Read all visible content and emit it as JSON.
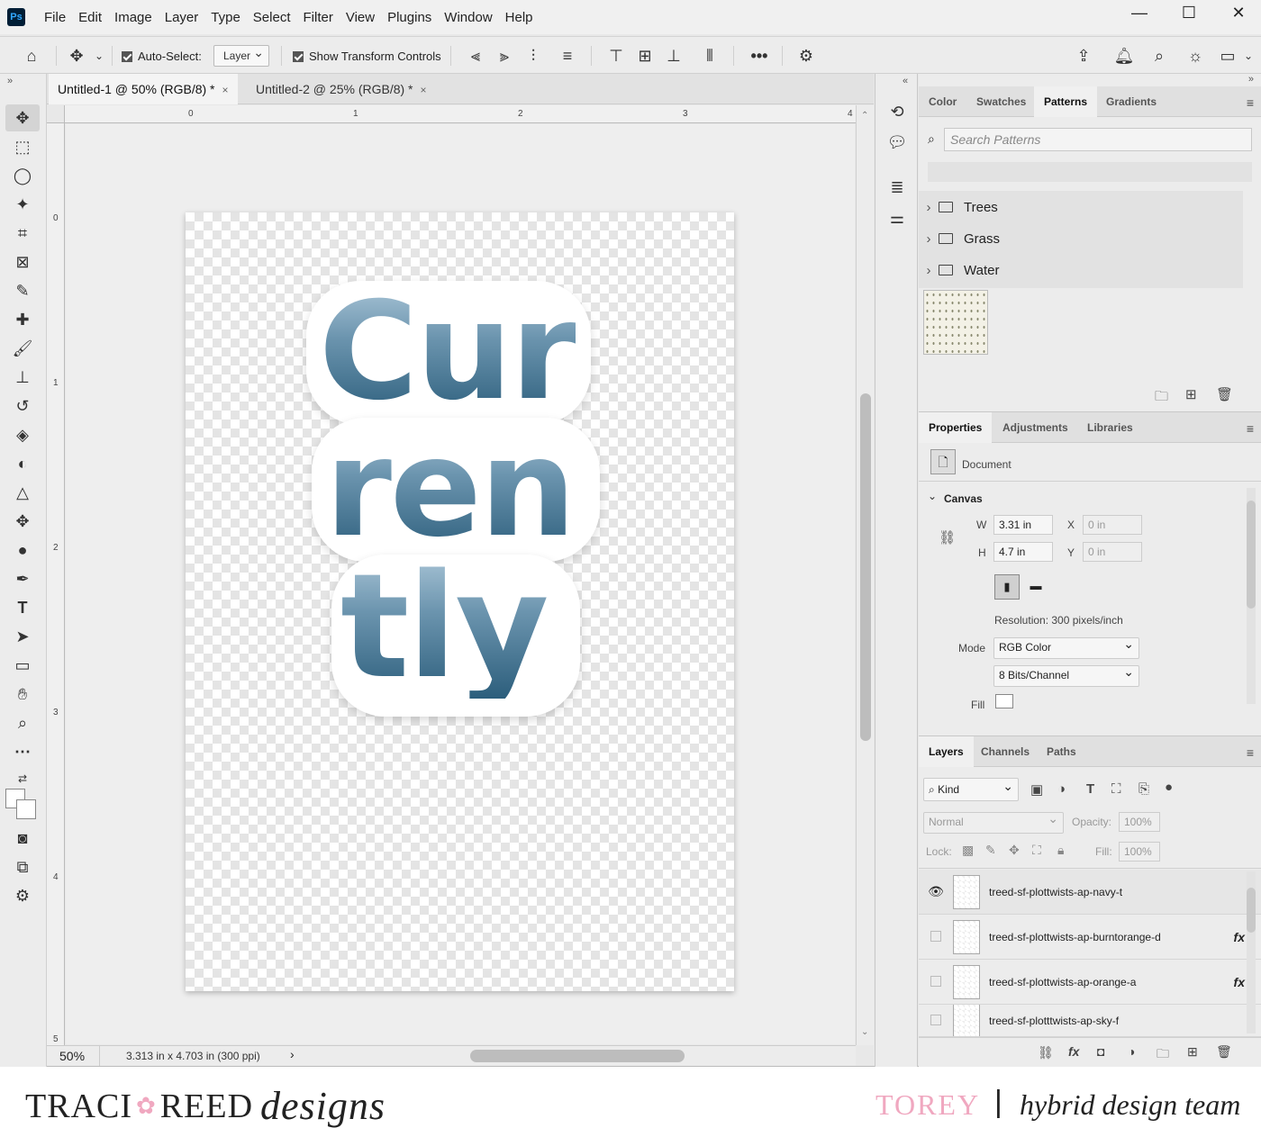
{
  "app": {
    "logo": "Ps"
  },
  "menu": [
    "File",
    "Edit",
    "Image",
    "Layer",
    "Type",
    "Select",
    "Filter",
    "View",
    "Plugins",
    "Window",
    "Help"
  ],
  "window_controls": {
    "minimize": "—",
    "maximize": "☐",
    "close": "✕"
  },
  "options_bar": {
    "auto_select_label": "Auto-Select:",
    "auto_select_target": "Layer",
    "show_transform_label": "Show Transform Controls",
    "more": "•••"
  },
  "doc_tabs": [
    {
      "label": "Untitled-1 @ 50% (RGB/8) *",
      "close": "×"
    },
    {
      "label": "Untitled-2 @ 25% (RGB/8) *",
      "close": "×"
    }
  ],
  "ruler": {
    "h": [
      "0",
      "1",
      "2",
      "3",
      "4"
    ],
    "v": [
      "0",
      "1",
      "2",
      "3",
      "4",
      "5"
    ]
  },
  "canvas_art": {
    "lines": [
      "Cur",
      "ren",
      "tly"
    ]
  },
  "status": {
    "zoom": "50%",
    "doc_info": "3.313 in x 4.703 in (300 ppi)",
    "arrow": "›"
  },
  "patterns_panel": {
    "tabs": [
      "Color",
      "Swatches",
      "Patterns",
      "Gradients"
    ],
    "active_tab": "Patterns",
    "search_placeholder": "Search Patterns",
    "folders": [
      "Trees",
      "Grass",
      "Water"
    ]
  },
  "properties_panel": {
    "tabs": [
      "Properties",
      "Adjustments",
      "Libraries"
    ],
    "active_tab": "Properties",
    "doc_label": "Document",
    "section": "Canvas",
    "w_label": "W",
    "w_value": "3.31 in",
    "h_label": "H",
    "h_value": "4.7 in",
    "x_label": "X",
    "x_value": "0 in",
    "y_label": "Y",
    "y_value": "0 in",
    "resolution": "Resolution: 300 pixels/inch",
    "mode_label": "Mode",
    "mode_value": "RGB Color",
    "bits_value": "8 Bits/Channel",
    "fill_label": "Fill"
  },
  "layers_panel": {
    "tabs": [
      "Layers",
      "Channels",
      "Paths"
    ],
    "active_tab": "Layers",
    "kind": "Kind",
    "blend": "Normal",
    "opacity_label": "Opacity:",
    "opacity_value": "100%",
    "lock_label": "Lock:",
    "fill_label": "Fill:",
    "fill_value": "100%",
    "layers": [
      {
        "name": "treed-sf-plottwists-ap-navy-t",
        "visible": true,
        "fx": ""
      },
      {
        "name": "treed-sf-plottwists-ap-burntorange-d",
        "visible": false,
        "fx": "fx"
      },
      {
        "name": "treed-sf-plottwists-ap-orange-a",
        "visible": false,
        "fx": "fx"
      },
      {
        "name": "treed-sf-plotttwists-ap-sky-f",
        "visible": false,
        "fx": ""
      }
    ]
  },
  "branding": {
    "left_a": "TRACI",
    "left_b": "REED",
    "left_script": "designs",
    "right_name": "TOREY",
    "right_sep": "|",
    "right_team": "hybrid design team"
  },
  "colors": {
    "accent_pink": "#f0a8c0",
    "glitter_dark": "#2c5e7c",
    "glitter_light": "#a8c4d6"
  }
}
